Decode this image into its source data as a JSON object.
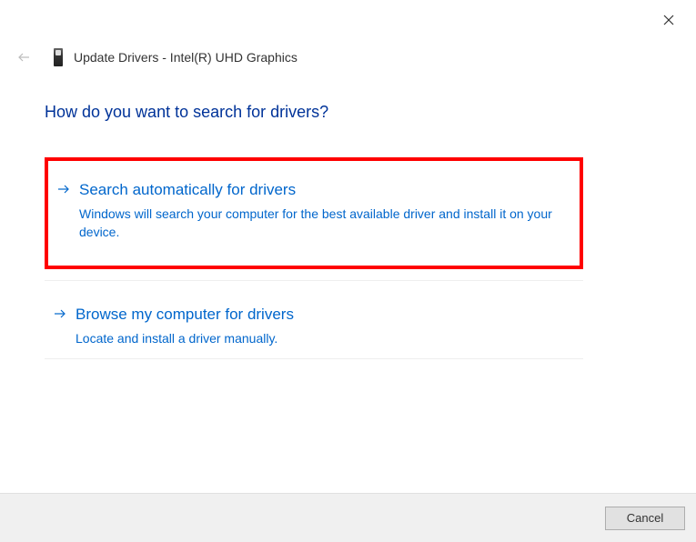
{
  "header": {
    "title": "Update Drivers - Intel(R) UHD Graphics"
  },
  "page": {
    "heading": "How do you want to search for drivers?"
  },
  "options": [
    {
      "title": "Search automatically for drivers",
      "description": "Windows will search your computer for the best available driver and install it on your device."
    },
    {
      "title": "Browse my computer for drivers",
      "description": "Locate and install a driver manually."
    }
  ],
  "footer": {
    "cancel_label": "Cancel"
  }
}
